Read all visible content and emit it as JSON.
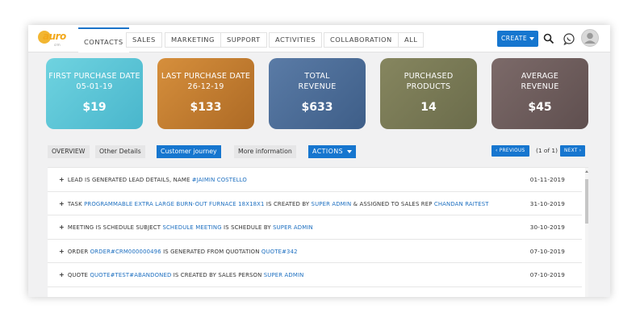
{
  "brand": {
    "name": "auro",
    "sub": "crm"
  },
  "nav": {
    "tabs": [
      "CONTACTS",
      "SALES",
      "MARKETING",
      "SUPPORT",
      "ACTIVITIES",
      "COLLABORATION",
      "ALL"
    ],
    "active": "CONTACTS",
    "create_label": "CREATE"
  },
  "icons": {
    "search": "search-icon",
    "chat": "chat-icon",
    "avatar": "user-avatar-icon"
  },
  "cards": [
    {
      "label_line1": "FIRST PURCHASE DATE",
      "label_line2": "05-01-19",
      "value": "$19",
      "color": "#4fbfd2"
    },
    {
      "label_line1": "LAST PURCHASE DATE",
      "label_line2": "26-12-19",
      "value": "$133",
      "color": "#c27a2c"
    },
    {
      "label_line1": "TOTAL",
      "label_line2": "REVENUE",
      "value": "$633",
      "color": "#4a6c96"
    },
    {
      "label_line1": "PURCHASED",
      "label_line2": "PRODUCTS",
      "value": "14",
      "color": "#7a7a56"
    },
    {
      "label_line1": "AVERAGE",
      "label_line2": "REVENUE",
      "value": "$45",
      "color": "#6e5c5c"
    }
  ],
  "subtabs": {
    "overview": "OVERVIEW",
    "other_details": "Other Details",
    "customer_journey": "Customer journey",
    "more_information": "More information",
    "actions": "ACTIONS",
    "active": "Customer journey"
  },
  "pager": {
    "previous": "PREVIOUS",
    "page_text": "(1 of 1)",
    "next": "NEXT"
  },
  "journey": [
    {
      "parts": [
        {
          "t": "LEAD IS GENERATED LEAD DETAILS, NAME ",
          "link": false
        },
        {
          "t": "#JAIMIN COSTELLO",
          "link": true
        }
      ],
      "date": "01-11-2019"
    },
    {
      "parts": [
        {
          "t": "TASK ",
          "link": false
        },
        {
          "t": "PROGRAMMABLE EXTRA LARGE BURN-OUT FURNACE 18X18X1",
          "link": true
        },
        {
          "t": " IS CREATED BY ",
          "link": false
        },
        {
          "t": "SUPER ADMIN",
          "link": true
        },
        {
          "t": " & ASSIGNED TO SALES REP ",
          "link": false
        },
        {
          "t": "CHANDAN RAITEST",
          "link": true
        }
      ],
      "date": "31-10-2019"
    },
    {
      "parts": [
        {
          "t": "MEETING IS SCHEDULE SUBJECT ",
          "link": false
        },
        {
          "t": "SCHEDULE MEETING",
          "link": true
        },
        {
          "t": " IS SCHEDULE BY ",
          "link": false
        },
        {
          "t": "SUPER ADMIN",
          "link": true
        }
      ],
      "date": "30-10-2019"
    },
    {
      "parts": [
        {
          "t": "ORDER ",
          "link": false
        },
        {
          "t": "ORDER#CRM000000496",
          "link": true
        },
        {
          "t": " IS GENERATED FROM QUOTATION ",
          "link": false
        },
        {
          "t": "QUOTE#342",
          "link": true
        }
      ],
      "date": "07-10-2019"
    },
    {
      "parts": [
        {
          "t": "QUOTE ",
          "link": false
        },
        {
          "t": "QUOTE#TEST#ABANDONED",
          "link": true
        },
        {
          "t": " IS CREATED BY SALES PERSON ",
          "link": false
        },
        {
          "t": "SUPER ADMIN",
          "link": true
        }
      ],
      "date": "07-10-2019"
    },
    {
      "parts": [],
      "date": ""
    }
  ],
  "colors": {
    "accent": "#1676cf",
    "link": "#1d6fc0"
  }
}
